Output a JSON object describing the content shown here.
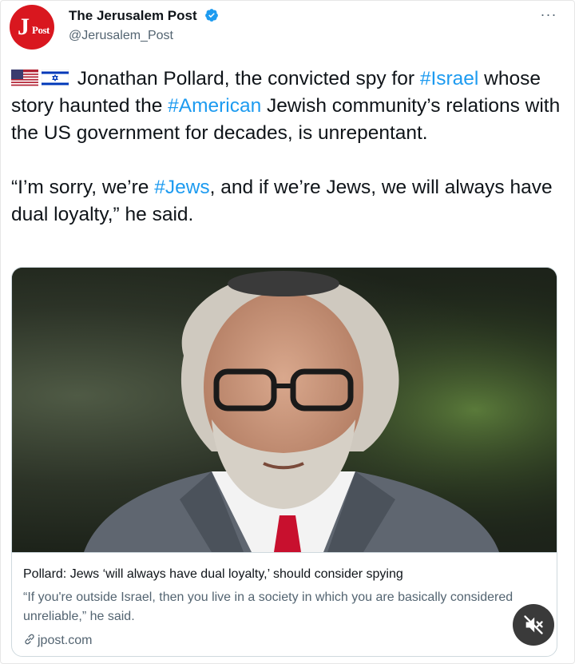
{
  "account": {
    "name": "The Jerusalem Post",
    "handle": "@Jerusalem_Post",
    "avatar_text": "JPost",
    "verified": true,
    "brand_color": "#d9171f",
    "verified_color": "#1d9bf0"
  },
  "more_label": "···",
  "tweet": {
    "para1": {
      "flags": [
        "us-flag-icon",
        "israel-flag-icon"
      ],
      "t1": " Jonathan Pollard, the convicted spy for ",
      "h1": "#Israel",
      "t2": " whose story haunted the ",
      "h2": "#American",
      "t3": " Jewish community’s relations with the US government for decades, is unrepentant."
    },
    "para2": {
      "t1": "“I’m sorry, we’re ",
      "h1": "#Jews",
      "t2": ", and if we’re Jews, we will always have dual loyalty,” he said."
    },
    "hashtag_color": "#1d9bf0"
  },
  "card": {
    "image": "portrait-photo",
    "title": "Pollard: Jews ‘will always have dual loyalty,’ should consider spying",
    "description": "“If you're outside Israel, then you live in a society in which you are basically considered unreliable,” he said.",
    "domain": "jpost.com"
  },
  "media_control": {
    "icon": "muted-speaker-icon"
  }
}
